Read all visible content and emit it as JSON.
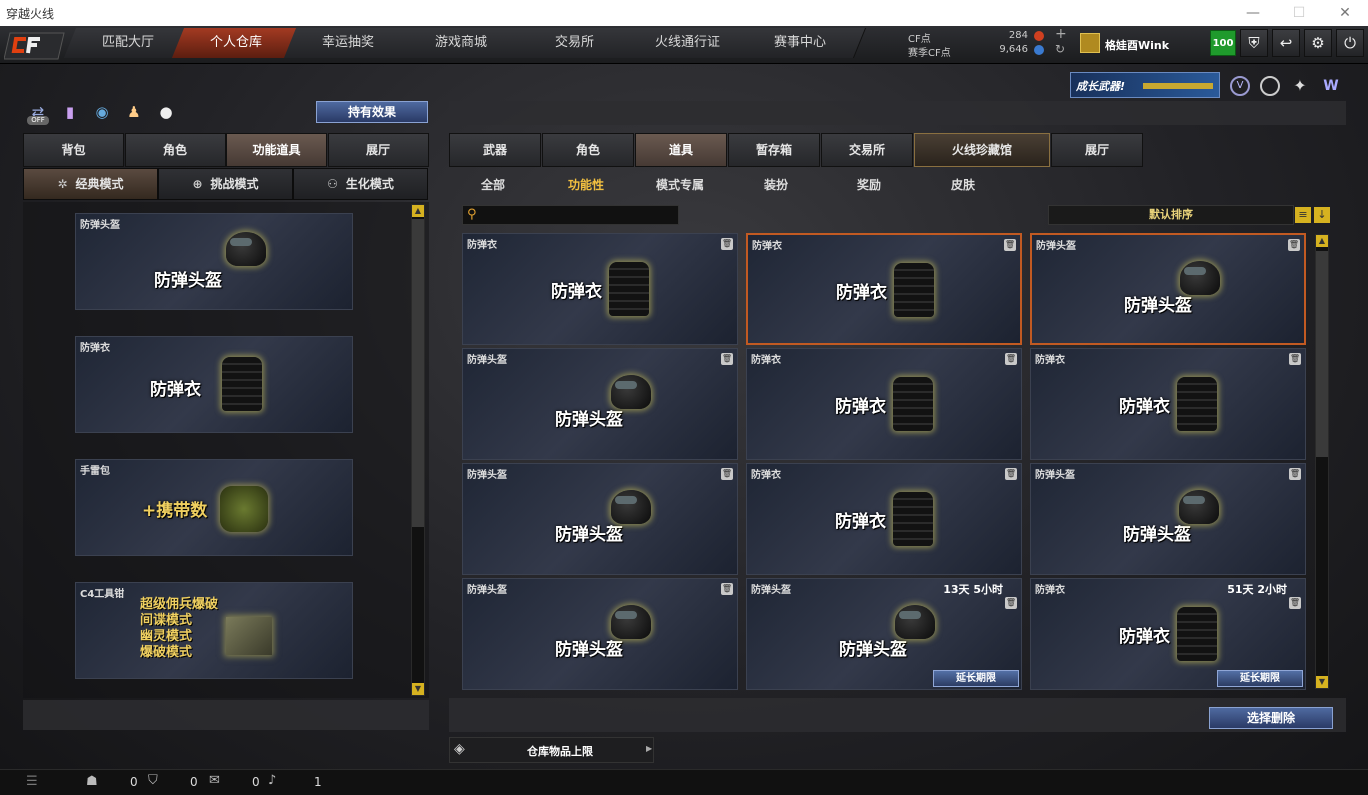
{
  "window": {
    "title": "穿越火线"
  },
  "nav": {
    "tabs": [
      "匹配大厅",
      "个人仓库",
      "幸运抽奖",
      "游戏商城",
      "交易所",
      "火线通行证",
      "赛事中心"
    ],
    "active_index": 1
  },
  "currency": {
    "cf_label": "CF点",
    "cf_value": "284",
    "match_label": "赛季CF点",
    "match_value": "9,646"
  },
  "user": {
    "name": "格娃酉Wink",
    "level": "100"
  },
  "left": {
    "status_off": "OFF",
    "effect_button": "持有效果",
    "tabs": [
      "背包",
      "角色",
      "功能道具",
      "展厅"
    ],
    "active_tab": 2,
    "modes": [
      "经典模式",
      "挑战模式",
      "生化模式"
    ],
    "active_mode": 0,
    "items": [
      {
        "label": "防弹头盔",
        "name": "防弹头盔"
      },
      {
        "label": "防弹衣",
        "name": "防弹衣"
      },
      {
        "label": "手雷包",
        "name": "+携带数"
      },
      {
        "label": "C4工具钳",
        "lines": [
          "超级佣兵爆破",
          "间谍模式",
          "幽灵模式",
          "爆破模式"
        ]
      }
    ]
  },
  "right": {
    "banner": "成长武器!",
    "tabs": [
      "武器",
      "角色",
      "道具",
      "暂存箱",
      "交易所",
      "火线珍藏馆",
      "展厅"
    ],
    "active_tab": 2,
    "subtabs": [
      "全部",
      "功能性",
      "模式专属",
      "装扮",
      "奖励",
      "皮肤"
    ],
    "active_subtab": 1,
    "search_placeholder": "",
    "sort_label": "默认排序",
    "cards": [
      {
        "label": "防弹衣",
        "name": "防弹衣",
        "kind": "vest",
        "selected": false
      },
      {
        "label": "防弹衣",
        "name": "防弹衣",
        "kind": "vest",
        "selected": true
      },
      {
        "label": "防弹头盔",
        "name": "防弹头盔",
        "kind": "helmet",
        "selected": true
      },
      {
        "label": "防弹头盔",
        "name": "防弹头盔",
        "kind": "helmet",
        "selected": false
      },
      {
        "label": "防弹衣",
        "name": "防弹衣",
        "kind": "vest",
        "selected": false
      },
      {
        "label": "防弹衣",
        "name": "防弹衣",
        "kind": "vest",
        "selected": false
      },
      {
        "label": "防弹头盔",
        "name": "防弹头盔",
        "kind": "helmet",
        "selected": false
      },
      {
        "label": "防弹衣",
        "name": "防弹衣",
        "kind": "vest",
        "selected": false
      },
      {
        "label": "防弹头盔",
        "name": "防弹头盔",
        "kind": "helmet",
        "selected": false
      },
      {
        "label": "防弹头盔",
        "name": "防弹头盔",
        "kind": "helmet",
        "selected": false
      },
      {
        "label": "防弹头盔",
        "name": "防弹头盔",
        "kind": "helmet",
        "selected": false,
        "timer": "13天 5小时",
        "extend": "延长期限"
      },
      {
        "label": "防弹衣",
        "name": "防弹衣",
        "kind": "vest",
        "selected": false,
        "timer": "51天 2小时",
        "extend": "延长期限"
      }
    ],
    "delete_button": "选择删除",
    "capacity_label": "仓库物品上限"
  },
  "statusbar": {
    "values": [
      "0",
      "0",
      "0",
      "1"
    ]
  }
}
